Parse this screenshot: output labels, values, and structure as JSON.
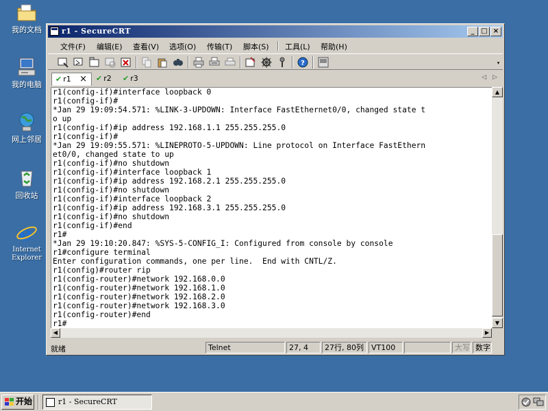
{
  "desktop": {
    "icons": [
      {
        "label": "我的文档",
        "icon": "my-documents-folder-icon"
      },
      {
        "label": "我的电脑",
        "icon": "my-computer-icon"
      },
      {
        "label": "网上邻居",
        "icon": "network-places-icon"
      },
      {
        "label": "回收站",
        "icon": "recycle-bin-icon"
      },
      {
        "label": "Internet Explorer",
        "icon": "internet-explorer-icon"
      }
    ]
  },
  "window": {
    "title": "r1 - SecureCRT",
    "controls": {
      "minimize": "_",
      "maximize": "□",
      "close": "×"
    }
  },
  "menu": {
    "items": [
      "文件(F)",
      "编辑(E)",
      "查看(V)",
      "选项(O)",
      "传输(T)",
      "脚本(S)",
      "工具(L)",
      "帮助(H)"
    ]
  },
  "toolbar": {
    "buttons": [
      "connect-icon",
      "quick-connect-icon",
      "connect-tab-icon",
      "reconnect-icon",
      "disconnect-icon",
      "copy-icon",
      "paste-icon",
      "find-icon",
      "print-icon",
      "print-selection-icon",
      "print-setup-icon",
      "session-options-icon",
      "global-options-icon",
      "keymap-icon",
      "help-icon",
      "sftp-icon"
    ]
  },
  "tabs": {
    "items": [
      {
        "label": "r1",
        "active": true
      },
      {
        "label": "r2",
        "active": false
      },
      {
        "label": "r3",
        "active": false
      }
    ],
    "close_glyph": "×",
    "prev_glyph": "◁",
    "next_glyph": "▷"
  },
  "terminal": {
    "lines": [
      "r1(config-if)#interface loopback 0",
      "r1(config-if)#",
      "*Jan 29 19:09:54.571: %LINK-3-UPDOWN: Interface FastEthernet0/0, changed state t",
      "o up",
      "r1(config-if)#ip address 192.168.1.1 255.255.255.0",
      "r1(config-if)#",
      "*Jan 29 19:09:55.571: %LINEPROTO-5-UPDOWN: Line protocol on Interface FastEthern",
      "et0/0, changed state to up",
      "r1(config-if)#no shutdown",
      "r1(config-if)#interface loopback 1",
      "r1(config-if)#ip address 192.168.2.1 255.255.255.0",
      "r1(config-if)#no shutdown",
      "r1(config-if)#interface loopback 2",
      "r1(config-if)#ip address 192.168.3.1 255.255.255.0",
      "r1(config-if)#no shutdown",
      "r1(config-if)#end",
      "r1#",
      "*Jan 29 19:10:20.847: %SYS-5-CONFIG_I: Configured from console by console",
      "r1#configure terminal",
      "Enter configuration commands, one per line.  End with CNTL/Z.",
      "r1(config)#router rip",
      "r1(config-router)#network 192.168.0.0",
      "r1(config-router)#network 192.168.1.0",
      "r1(config-router)#network 192.168.2.0",
      "r1(config-router)#network 192.168.3.0",
      "r1(config-router)#end",
      "r1#"
    ]
  },
  "status": {
    "ready": "就绪",
    "protocol": "Telnet",
    "cursor": "27, 4",
    "size": "27行, 80列",
    "terminal_type": "VT100",
    "blank": "",
    "caps": "大写",
    "num": "数字"
  },
  "taskbar": {
    "start_label": "开始",
    "task_label": "r1 - SecureCRT"
  }
}
